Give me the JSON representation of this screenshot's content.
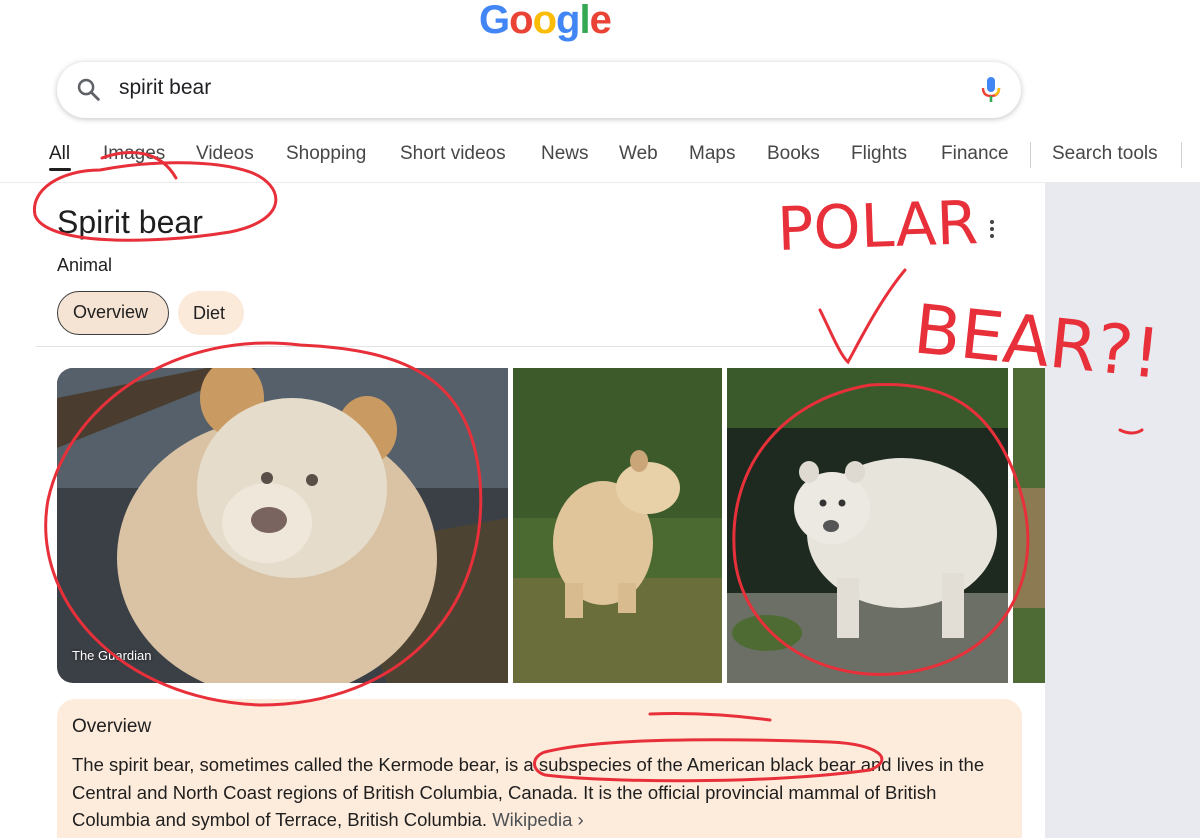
{
  "logo": {
    "letters": [
      "G",
      "o",
      "o",
      "g",
      "l",
      "e"
    ]
  },
  "search": {
    "query": "spirit bear"
  },
  "tabs": [
    "All",
    "Images",
    "Videos",
    "Shopping",
    "Short videos",
    "News",
    "Web",
    "Maps",
    "Books",
    "Flights",
    "Finance"
  ],
  "search_tools_label": "Search tools",
  "knowledge_panel": {
    "title": "Spirit bear",
    "subtitle": "Animal",
    "chips": [
      "Overview",
      "Diet"
    ],
    "image_source": "The Guardian",
    "overview": {
      "heading": "Overview",
      "text": "The spirit bear, sometimes called the Kermode bear, is a subspecies of the American black bear and lives in the Central and North Coast regions of British Columbia, Canada. It is the official provincial mammal of British Columbia and symbol of Terrace, British Columbia.",
      "link_label": "Wikipedia",
      "link_chevron": "›"
    }
  },
  "annotation": {
    "line1": "POLAR",
    "line2": "BEAR?!",
    "color": "#e8303a"
  },
  "colors": {
    "chip_active": "#f5e3d3",
    "card_bg": "#fdebdb",
    "side_bg": "#e8eaef"
  }
}
